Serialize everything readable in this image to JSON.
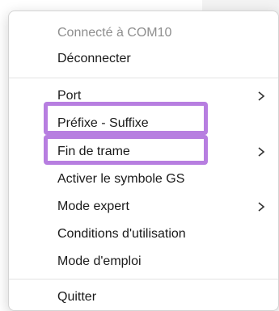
{
  "menu": {
    "status": "Connecté à COM10",
    "disconnect": "Déconnecter",
    "port": "Port",
    "prefix_suffix": "Préfixe - Suffixe",
    "end_of_frame": "Fin de trame",
    "enable_gs": "Activer le symbole GS",
    "expert_mode": "Mode expert",
    "terms": "Conditions d'utilisation",
    "manual": "Mode d'emploi",
    "quit": "Quitter"
  },
  "icons": {
    "submenu": "chevron-right-icon"
  },
  "colors": {
    "highlight": "#b77ee0",
    "text": "#1a1a1a",
    "disabled_text": "#8e8e8e"
  }
}
